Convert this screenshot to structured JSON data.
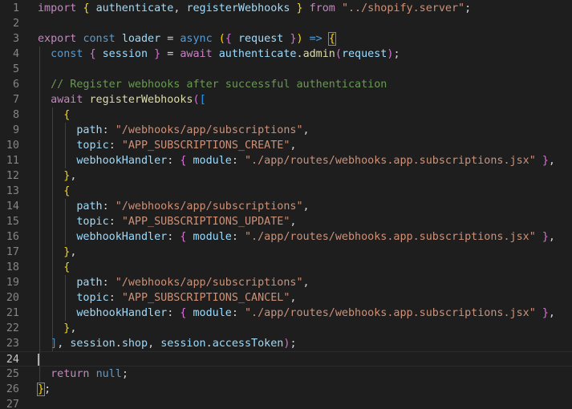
{
  "editor": {
    "lines": [
      {
        "n": "1",
        "tokens": [
          [
            "import",
            "ctl"
          ],
          [
            " ",
            "pun"
          ],
          [
            "{",
            "b1"
          ],
          [
            " ",
            "pun"
          ],
          [
            "authenticate",
            "var"
          ],
          [
            ", ",
            "pun"
          ],
          [
            "registerWebhooks",
            "var"
          ],
          [
            " ",
            "pun"
          ],
          [
            "}",
            "b1"
          ],
          [
            " ",
            "pun"
          ],
          [
            "from",
            "ctl"
          ],
          [
            " ",
            "pun"
          ],
          [
            "\"../shopify.server\"",
            "str"
          ],
          [
            ";",
            "pun"
          ]
        ]
      },
      {
        "n": "2",
        "tokens": []
      },
      {
        "n": "3",
        "tokens": [
          [
            "export",
            "ctl"
          ],
          [
            " ",
            "pun"
          ],
          [
            "const",
            "kw"
          ],
          [
            " ",
            "pun"
          ],
          [
            "loader",
            "var"
          ],
          [
            " = ",
            "pun"
          ],
          [
            "async",
            "kw"
          ],
          [
            " ",
            "pun"
          ],
          [
            "(",
            "b1"
          ],
          [
            "{",
            "b2"
          ],
          [
            " ",
            "pun"
          ],
          [
            "request",
            "var"
          ],
          [
            " ",
            "pun"
          ],
          [
            "}",
            "b2"
          ],
          [
            ")",
            "b1"
          ],
          [
            " ",
            "pun"
          ],
          [
            "=>",
            "kw"
          ],
          [
            " ",
            "pun"
          ],
          [
            "{",
            "b1m"
          ]
        ]
      },
      {
        "n": "4",
        "tokens": [
          [
            "  ",
            "pun"
          ],
          [
            "const",
            "kw"
          ],
          [
            " ",
            "pun"
          ],
          [
            "{",
            "b2"
          ],
          [
            " ",
            "pun"
          ],
          [
            "session",
            "var"
          ],
          [
            " ",
            "pun"
          ],
          [
            "}",
            "b2"
          ],
          [
            " = ",
            "pun"
          ],
          [
            "await",
            "ctl"
          ],
          [
            " ",
            "pun"
          ],
          [
            "authenticate",
            "var"
          ],
          [
            ".",
            "pun"
          ],
          [
            "admin",
            "fn"
          ],
          [
            "(",
            "b2"
          ],
          [
            "request",
            "var"
          ],
          [
            ")",
            "b2"
          ],
          [
            ";",
            "pun"
          ]
        ]
      },
      {
        "n": "5",
        "tokens": []
      },
      {
        "n": "6",
        "tokens": [
          [
            "  ",
            "pun"
          ],
          [
            "// Register webhooks after successful authentication",
            "com"
          ]
        ]
      },
      {
        "n": "7",
        "tokens": [
          [
            "  ",
            "pun"
          ],
          [
            "await",
            "ctl"
          ],
          [
            " ",
            "pun"
          ],
          [
            "registerWebhooks",
            "fn"
          ],
          [
            "(",
            "b2"
          ],
          [
            "[",
            "b3"
          ]
        ]
      },
      {
        "n": "8",
        "tokens": [
          [
            "    ",
            "pun"
          ],
          [
            "{",
            "b1"
          ]
        ]
      },
      {
        "n": "9",
        "tokens": [
          [
            "      ",
            "pun"
          ],
          [
            "path",
            "var"
          ],
          [
            ": ",
            "pun"
          ],
          [
            "\"/webhooks/app/subscriptions\"",
            "str"
          ],
          [
            ",",
            "pun"
          ]
        ]
      },
      {
        "n": "10",
        "tokens": [
          [
            "      ",
            "pun"
          ],
          [
            "topic",
            "var"
          ],
          [
            ": ",
            "pun"
          ],
          [
            "\"APP_SUBSCRIPTIONS_CREATE\"",
            "str"
          ],
          [
            ",",
            "pun"
          ]
        ]
      },
      {
        "n": "11",
        "tokens": [
          [
            "      ",
            "pun"
          ],
          [
            "webhookHandler",
            "var"
          ],
          [
            ": ",
            "pun"
          ],
          [
            "{",
            "b2"
          ],
          [
            " ",
            "pun"
          ],
          [
            "module",
            "var"
          ],
          [
            ": ",
            "pun"
          ],
          [
            "\"./app/routes/webhooks.app.subscriptions.jsx\"",
            "str"
          ],
          [
            " ",
            "pun"
          ],
          [
            "}",
            "b2"
          ],
          [
            ",",
            "pun"
          ]
        ]
      },
      {
        "n": "12",
        "tokens": [
          [
            "    ",
            "pun"
          ],
          [
            "}",
            "b1"
          ],
          [
            ",",
            "pun"
          ]
        ]
      },
      {
        "n": "13",
        "tokens": [
          [
            "    ",
            "pun"
          ],
          [
            "{",
            "b1"
          ]
        ]
      },
      {
        "n": "14",
        "tokens": [
          [
            "      ",
            "pun"
          ],
          [
            "path",
            "var"
          ],
          [
            ": ",
            "pun"
          ],
          [
            "\"/webhooks/app/subscriptions\"",
            "str"
          ],
          [
            ",",
            "pun"
          ]
        ]
      },
      {
        "n": "15",
        "tokens": [
          [
            "      ",
            "pun"
          ],
          [
            "topic",
            "var"
          ],
          [
            ": ",
            "pun"
          ],
          [
            "\"APP_SUBSCRIPTIONS_UPDATE\"",
            "str"
          ],
          [
            ",",
            "pun"
          ]
        ]
      },
      {
        "n": "16",
        "tokens": [
          [
            "      ",
            "pun"
          ],
          [
            "webhookHandler",
            "var"
          ],
          [
            ": ",
            "pun"
          ],
          [
            "{",
            "b2"
          ],
          [
            " ",
            "pun"
          ],
          [
            "module",
            "var"
          ],
          [
            ": ",
            "pun"
          ],
          [
            "\"./app/routes/webhooks.app.subscriptions.jsx\"",
            "str"
          ],
          [
            " ",
            "pun"
          ],
          [
            "}",
            "b2"
          ],
          [
            ",",
            "pun"
          ]
        ]
      },
      {
        "n": "17",
        "tokens": [
          [
            "    ",
            "pun"
          ],
          [
            "}",
            "b1"
          ],
          [
            ",",
            "pun"
          ]
        ]
      },
      {
        "n": "18",
        "tokens": [
          [
            "    ",
            "pun"
          ],
          [
            "{",
            "b1"
          ]
        ]
      },
      {
        "n": "19",
        "tokens": [
          [
            "      ",
            "pun"
          ],
          [
            "path",
            "var"
          ],
          [
            ": ",
            "pun"
          ],
          [
            "\"/webhooks/app/subscriptions\"",
            "str"
          ],
          [
            ",",
            "pun"
          ]
        ]
      },
      {
        "n": "20",
        "tokens": [
          [
            "      ",
            "pun"
          ],
          [
            "topic",
            "var"
          ],
          [
            ": ",
            "pun"
          ],
          [
            "\"APP_SUBSCRIPTIONS_CANCEL\"",
            "str"
          ],
          [
            ",",
            "pun"
          ]
        ]
      },
      {
        "n": "21",
        "tokens": [
          [
            "      ",
            "pun"
          ],
          [
            "webhookHandler",
            "var"
          ],
          [
            ": ",
            "pun"
          ],
          [
            "{",
            "b2"
          ],
          [
            " ",
            "pun"
          ],
          [
            "module",
            "var"
          ],
          [
            ": ",
            "pun"
          ],
          [
            "\"./app/routes/webhooks.app.subscriptions.jsx\"",
            "str"
          ],
          [
            " ",
            "pun"
          ],
          [
            "}",
            "b2"
          ],
          [
            ",",
            "pun"
          ]
        ]
      },
      {
        "n": "22",
        "tokens": [
          [
            "    ",
            "pun"
          ],
          [
            "}",
            "b1"
          ],
          [
            ",",
            "pun"
          ]
        ]
      },
      {
        "n": "23",
        "tokens": [
          [
            "  ",
            "pun"
          ],
          [
            "]",
            "b3"
          ],
          [
            ", ",
            "pun"
          ],
          [
            "session",
            "var"
          ],
          [
            ".",
            "pun"
          ],
          [
            "shop",
            "var"
          ],
          [
            ", ",
            "pun"
          ],
          [
            "session",
            "var"
          ],
          [
            ".",
            "pun"
          ],
          [
            "accessToken",
            "var"
          ],
          [
            ")",
            "b2"
          ],
          [
            ";",
            "pun"
          ]
        ]
      },
      {
        "n": "24",
        "tokens": [],
        "current": true
      },
      {
        "n": "25",
        "tokens": [
          [
            "  ",
            "pun"
          ],
          [
            "return",
            "ctl"
          ],
          [
            " ",
            "pun"
          ],
          [
            "null",
            "kw"
          ],
          [
            ";",
            "pun"
          ]
        ]
      },
      {
        "n": "26",
        "tokens": [
          [
            "}",
            "b1m"
          ],
          [
            ";",
            "pun"
          ]
        ]
      },
      {
        "n": "27",
        "tokens": []
      }
    ]
  }
}
